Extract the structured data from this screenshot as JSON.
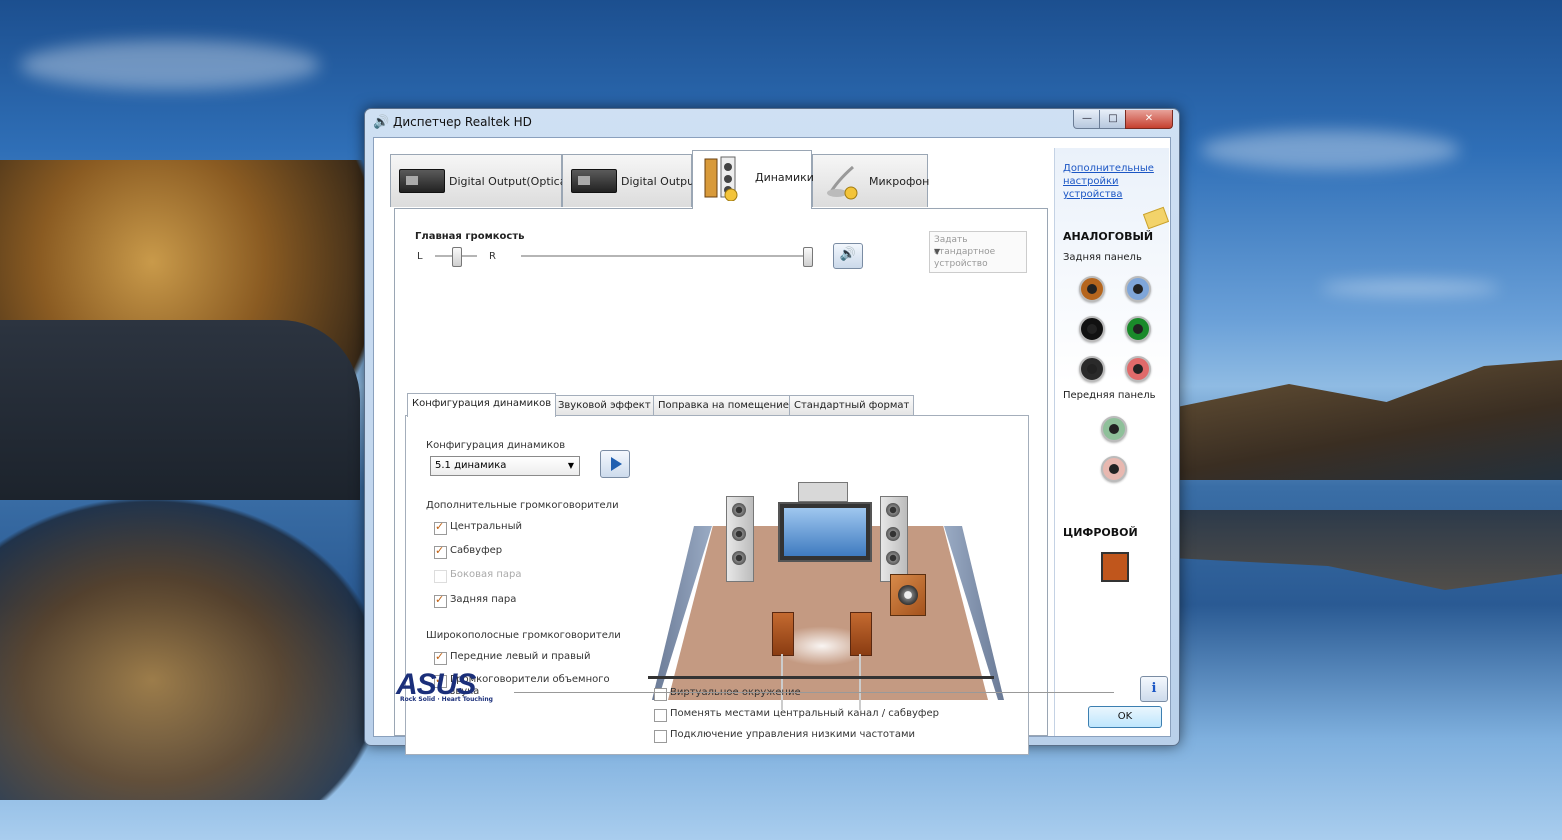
{
  "window": {
    "title": "Диспетчер Realtek HD"
  },
  "device_tabs": [
    {
      "label": "Digital Output(Optical)",
      "icon": "digital-output-box-icon"
    },
    {
      "label": "Digital Output",
      "icon": "digital-output-box-icon"
    },
    {
      "label": "Динамики",
      "icon": "speakers-icon",
      "active": true
    },
    {
      "label": "Микрофон",
      "icon": "microphone-icon"
    }
  ],
  "volume": {
    "label": "Главная громкость",
    "left": "L",
    "right": "R",
    "balance_percent": 50,
    "volume_percent": 100
  },
  "default_device": {
    "label": "Задать стандартное устройство"
  },
  "sub_tabs": [
    {
      "label": "Конфигурация динамиков",
      "active": true
    },
    {
      "label": "Звуковой эффект"
    },
    {
      "label": "Поправка на помещение"
    },
    {
      "label": "Стандартный формат"
    }
  ],
  "config": {
    "label": "Конфигурация динамиков",
    "selected": "5.1 динамика"
  },
  "optional_speakers": {
    "heading": "Дополнительные громкоговорители",
    "items": [
      {
        "label": "Центральный",
        "checked": true,
        "enabled": true
      },
      {
        "label": "Сабвуфер",
        "checked": true,
        "enabled": true
      },
      {
        "label": "Боковая пара",
        "checked": false,
        "enabled": false
      },
      {
        "label": "Задняя пара",
        "checked": true,
        "enabled": true
      }
    ]
  },
  "fullrange_speakers": {
    "heading": "Широкополосные громкоговорители",
    "items": [
      {
        "label": "Передние левый и правый",
        "checked": true
      },
      {
        "label": "Громкоговорители объемного звука",
        "checked": true
      }
    ]
  },
  "bottom_options": [
    {
      "label": "Виртуальное окружение",
      "checked": false
    },
    {
      "label": "Поменять местами центральный канал / сабвуфер",
      "checked": false
    },
    {
      "label": "Подключение управления низкими частотами",
      "checked": false
    }
  ],
  "side": {
    "link": "Дополнительные настройки устройства",
    "analog": "АНАЛОГОВЫЙ",
    "rear_panel": "Задняя панель",
    "front_panel": "Передняя панель",
    "digital": "ЦИФРОВОЙ",
    "rear_jacks": [
      "#b5651d",
      "#7fa6d9",
      "#111111",
      "#1a8a2a",
      "#2a2a2a",
      "#e06a6a"
    ],
    "front_jacks": [
      "#8fc09a",
      "#e8b8b0"
    ]
  },
  "footer": {
    "brand": "ASUS",
    "tagline": "Rock Solid · Heart Touching",
    "ok": "OK",
    "info": "i"
  }
}
